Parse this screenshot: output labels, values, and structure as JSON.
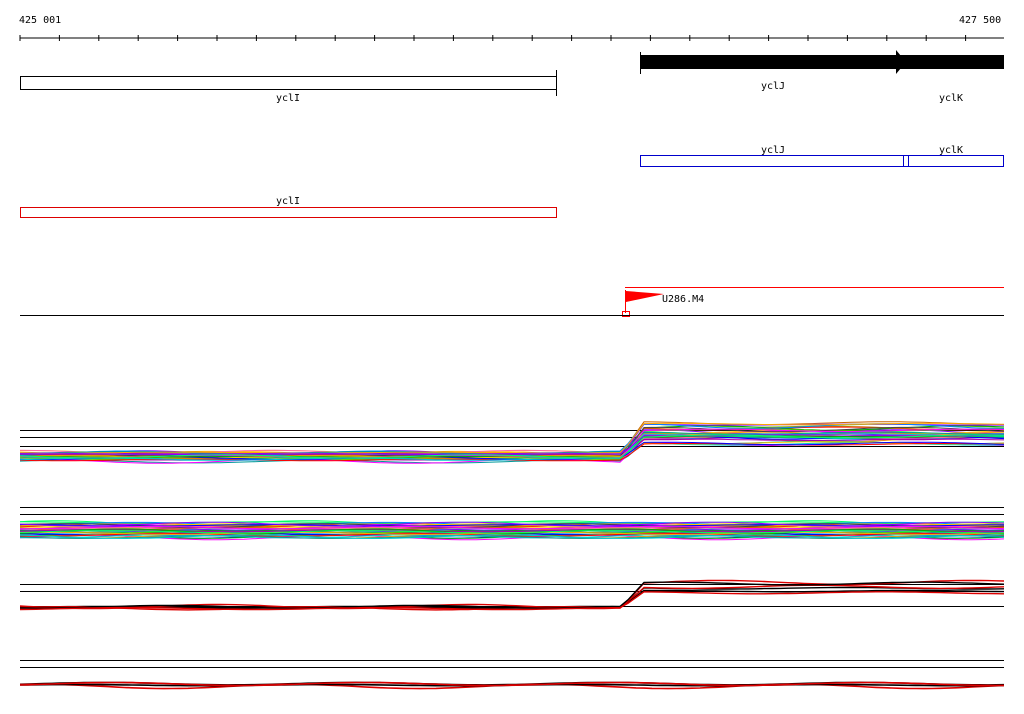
{
  "ruler": {
    "start_label": "425 001",
    "end_label": "427 500"
  },
  "genes": [
    {
      "label": "yclI"
    },
    {
      "label": "yclJ"
    },
    {
      "label": "yclK"
    }
  ],
  "tracks": {
    "blue_labels": [
      "yclJ",
      "yclK"
    ],
    "red_label": "yclI"
  },
  "marker": {
    "label": "U286.M4",
    "color": "#ff0000"
  },
  "colors": {
    "gene": "#000000",
    "blue_track": "#0000cc",
    "red_track": "#dd0000"
  }
}
